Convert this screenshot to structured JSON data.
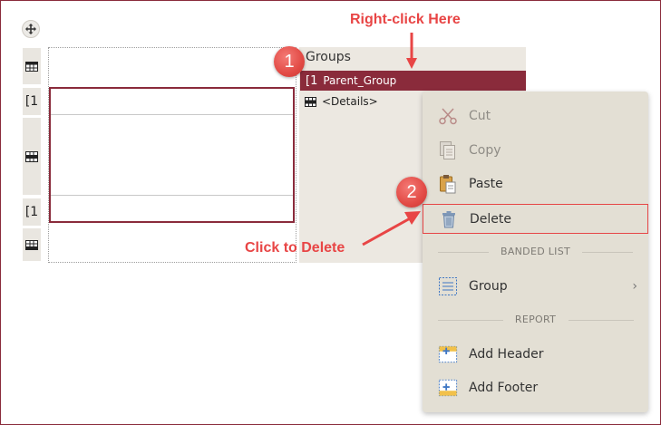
{
  "annotations": {
    "right_click_text": "Right-click Here",
    "click_delete_text": "Click to Delete",
    "badge1": "1",
    "badge2": "2",
    "accent_color": "#e84545"
  },
  "designer": {
    "row_bracket_1": "[1",
    "row_bracket_2": "[1"
  },
  "groups_pane": {
    "title": "Groups",
    "parent_group_bracket": "[1",
    "parent_group_label": "Parent_Group",
    "details_label": "<Details>",
    "selected_color": "#8a2b3b"
  },
  "context_menu": {
    "cut": "Cut",
    "copy": "Copy",
    "paste": "Paste",
    "delete": "Delete",
    "section_banded_list": "BANDED LIST",
    "group": "Group",
    "section_report": "REPORT",
    "add_header": "Add Header",
    "add_footer": "Add Footer"
  }
}
